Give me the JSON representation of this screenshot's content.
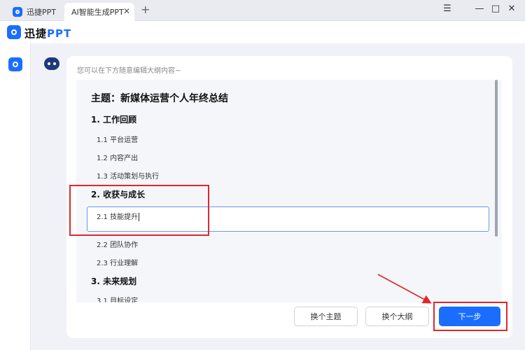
{
  "window": {
    "tabs": [
      {
        "label": "迅捷PPT"
      },
      {
        "label": "AI智能生成PPT"
      }
    ],
    "add_tab": "+",
    "controls": {
      "menu": "☰",
      "minimize": "—",
      "maximize": "□",
      "close": "✕"
    }
  },
  "app": {
    "name_prefix": "迅捷",
    "name_suffix": "PPT"
  },
  "editor": {
    "hint": "您可以在下方随意编辑大纲内容~",
    "title": "主题：新媒体运营个人年终总结",
    "sections": [
      {
        "heading": "1. 工作回顾",
        "items": [
          "1.1  平台运营",
          "1.2  内容产出",
          "1.3  活动策划与执行"
        ]
      },
      {
        "heading": "2. 收获与成长",
        "items": [
          "2.1  技能提升",
          "2.2  团队协作",
          "2.3  行业理解"
        ]
      },
      {
        "heading": "3. 未来规划",
        "items": [
          "3.1  目标设定"
        ]
      }
    ]
  },
  "footer": {
    "change_theme": "换个主题",
    "change_outline": "换个大纲",
    "next": "下一步"
  },
  "colors": {
    "brand": "#1a6dff",
    "annotation": "#e0262b"
  }
}
